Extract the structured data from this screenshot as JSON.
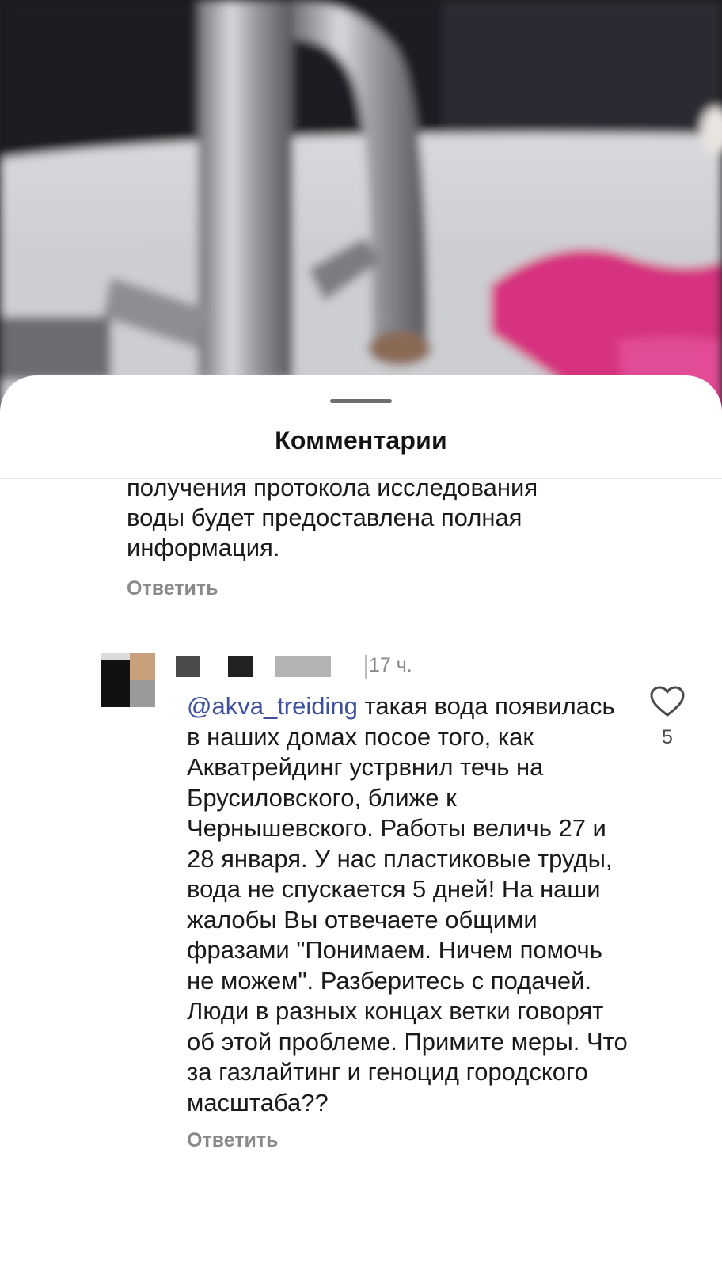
{
  "sheet": {
    "title": "Комментарии"
  },
  "comments": [
    {
      "text": "лабораторных исследований. После\nполучения протокола исследования\nводы будет предоставлена полная\nинформация.",
      "reply_label": "Ответить"
    },
    {
      "time": "17 ч.",
      "mention": "@akva_treiding",
      "text": " такая вода появилась в наших домах посое того, как Акватрейдинг устрвнил течь на Брусиловского, ближе к Чернышевского.  Работы величь 27 и 28 января.  У нас пластиковые труды, вода не спускается  5 дней!  На наши жалобы Вы отвечаете общими фразами \"Понимаем. Ничем помочь не можем\". Разберитесь с подачей. Люди в разных концах ветки говорят об этой проблеме. Примите меры. Что за газлайтинг и геноцид городского масштаба??",
      "reply_label": "Ответить",
      "likes": "5"
    }
  ],
  "icons": {
    "like": "heart-outline-icon"
  },
  "colors": {
    "mention": "#3d4f9e",
    "secondary_text": "#8a8a8a",
    "primary_text": "#1a1a1a"
  }
}
